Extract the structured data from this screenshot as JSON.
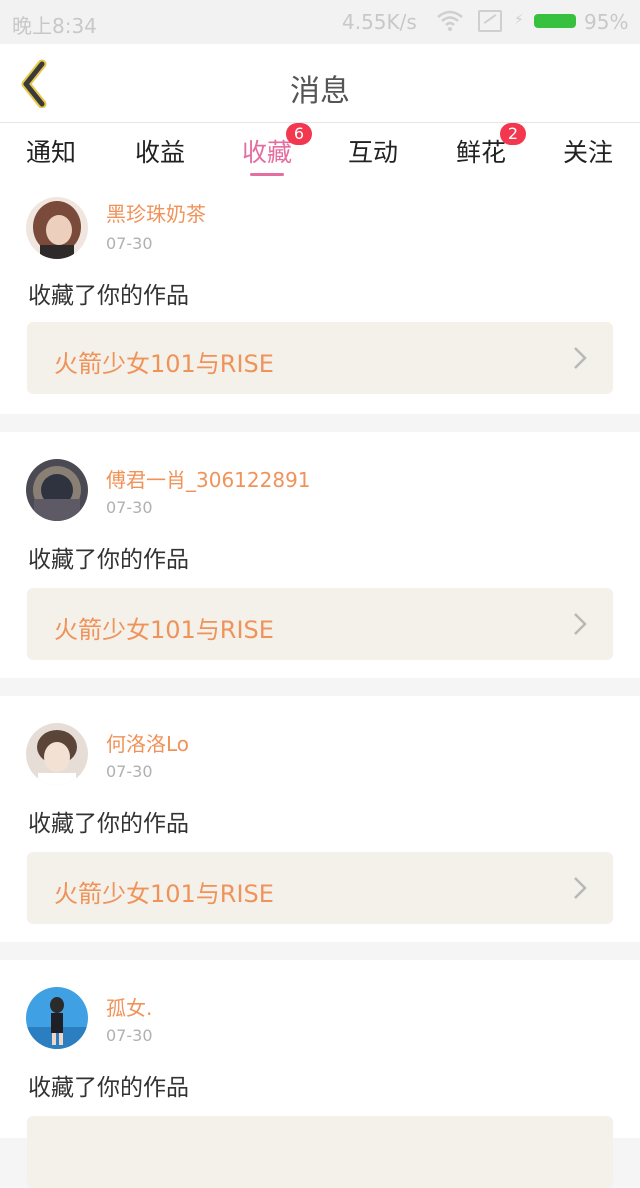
{
  "status_bar": {
    "time": "晚上8:34",
    "speed": "4.55K/s",
    "battery": "95%",
    "battery_color": "#38c13e",
    "icons": [
      "wifi-icon",
      "sim-icon",
      "charging-icon",
      "battery-icon"
    ]
  },
  "header": {
    "title": "消息",
    "back_icon": "chevron-left-icon",
    "accent_color": "#e5c84a"
  },
  "tabs": [
    {
      "label": "通知",
      "badge": null,
      "active": false
    },
    {
      "label": "收益",
      "badge": null,
      "active": false
    },
    {
      "label": "收藏",
      "badge": "6",
      "active": true
    },
    {
      "label": "互动",
      "badge": null,
      "active": false
    },
    {
      "label": "鲜花",
      "badge": "2",
      "active": false
    },
    {
      "label": "关注",
      "badge": null,
      "active": false
    }
  ],
  "active_tab_color": "#e56ea0",
  "badge_color": "#f2374e",
  "messages": [
    {
      "user": "黑珍珠奶茶",
      "date": "07-30",
      "action": "收藏了你的作品",
      "work": "火箭少女101与RISE",
      "avatar_colors": [
        "#7a4a3a",
        "#e9c9b4"
      ]
    },
    {
      "user": "傅君一肖_306122891",
      "date": "07-30",
      "action": "收藏了你的作品",
      "work": "火箭少女101与RISE",
      "avatar_colors": [
        "#3a3a48",
        "#8a7f74"
      ]
    },
    {
      "user": "何洛洛Lo",
      "date": "07-30",
      "action": "收藏了你的作品",
      "work": "火箭少女101与RISE",
      "avatar_colors": [
        "#d9cfc7",
        "#f3e2d4"
      ]
    },
    {
      "user": "孤女.",
      "date": "07-30",
      "action": "收藏了你的作品",
      "work": "",
      "avatar_colors": [
        "#3fa0e3",
        "#2b2b2b"
      ]
    }
  ],
  "name_color": "#f0935a",
  "chevron_icon": "chevron-right-icon"
}
